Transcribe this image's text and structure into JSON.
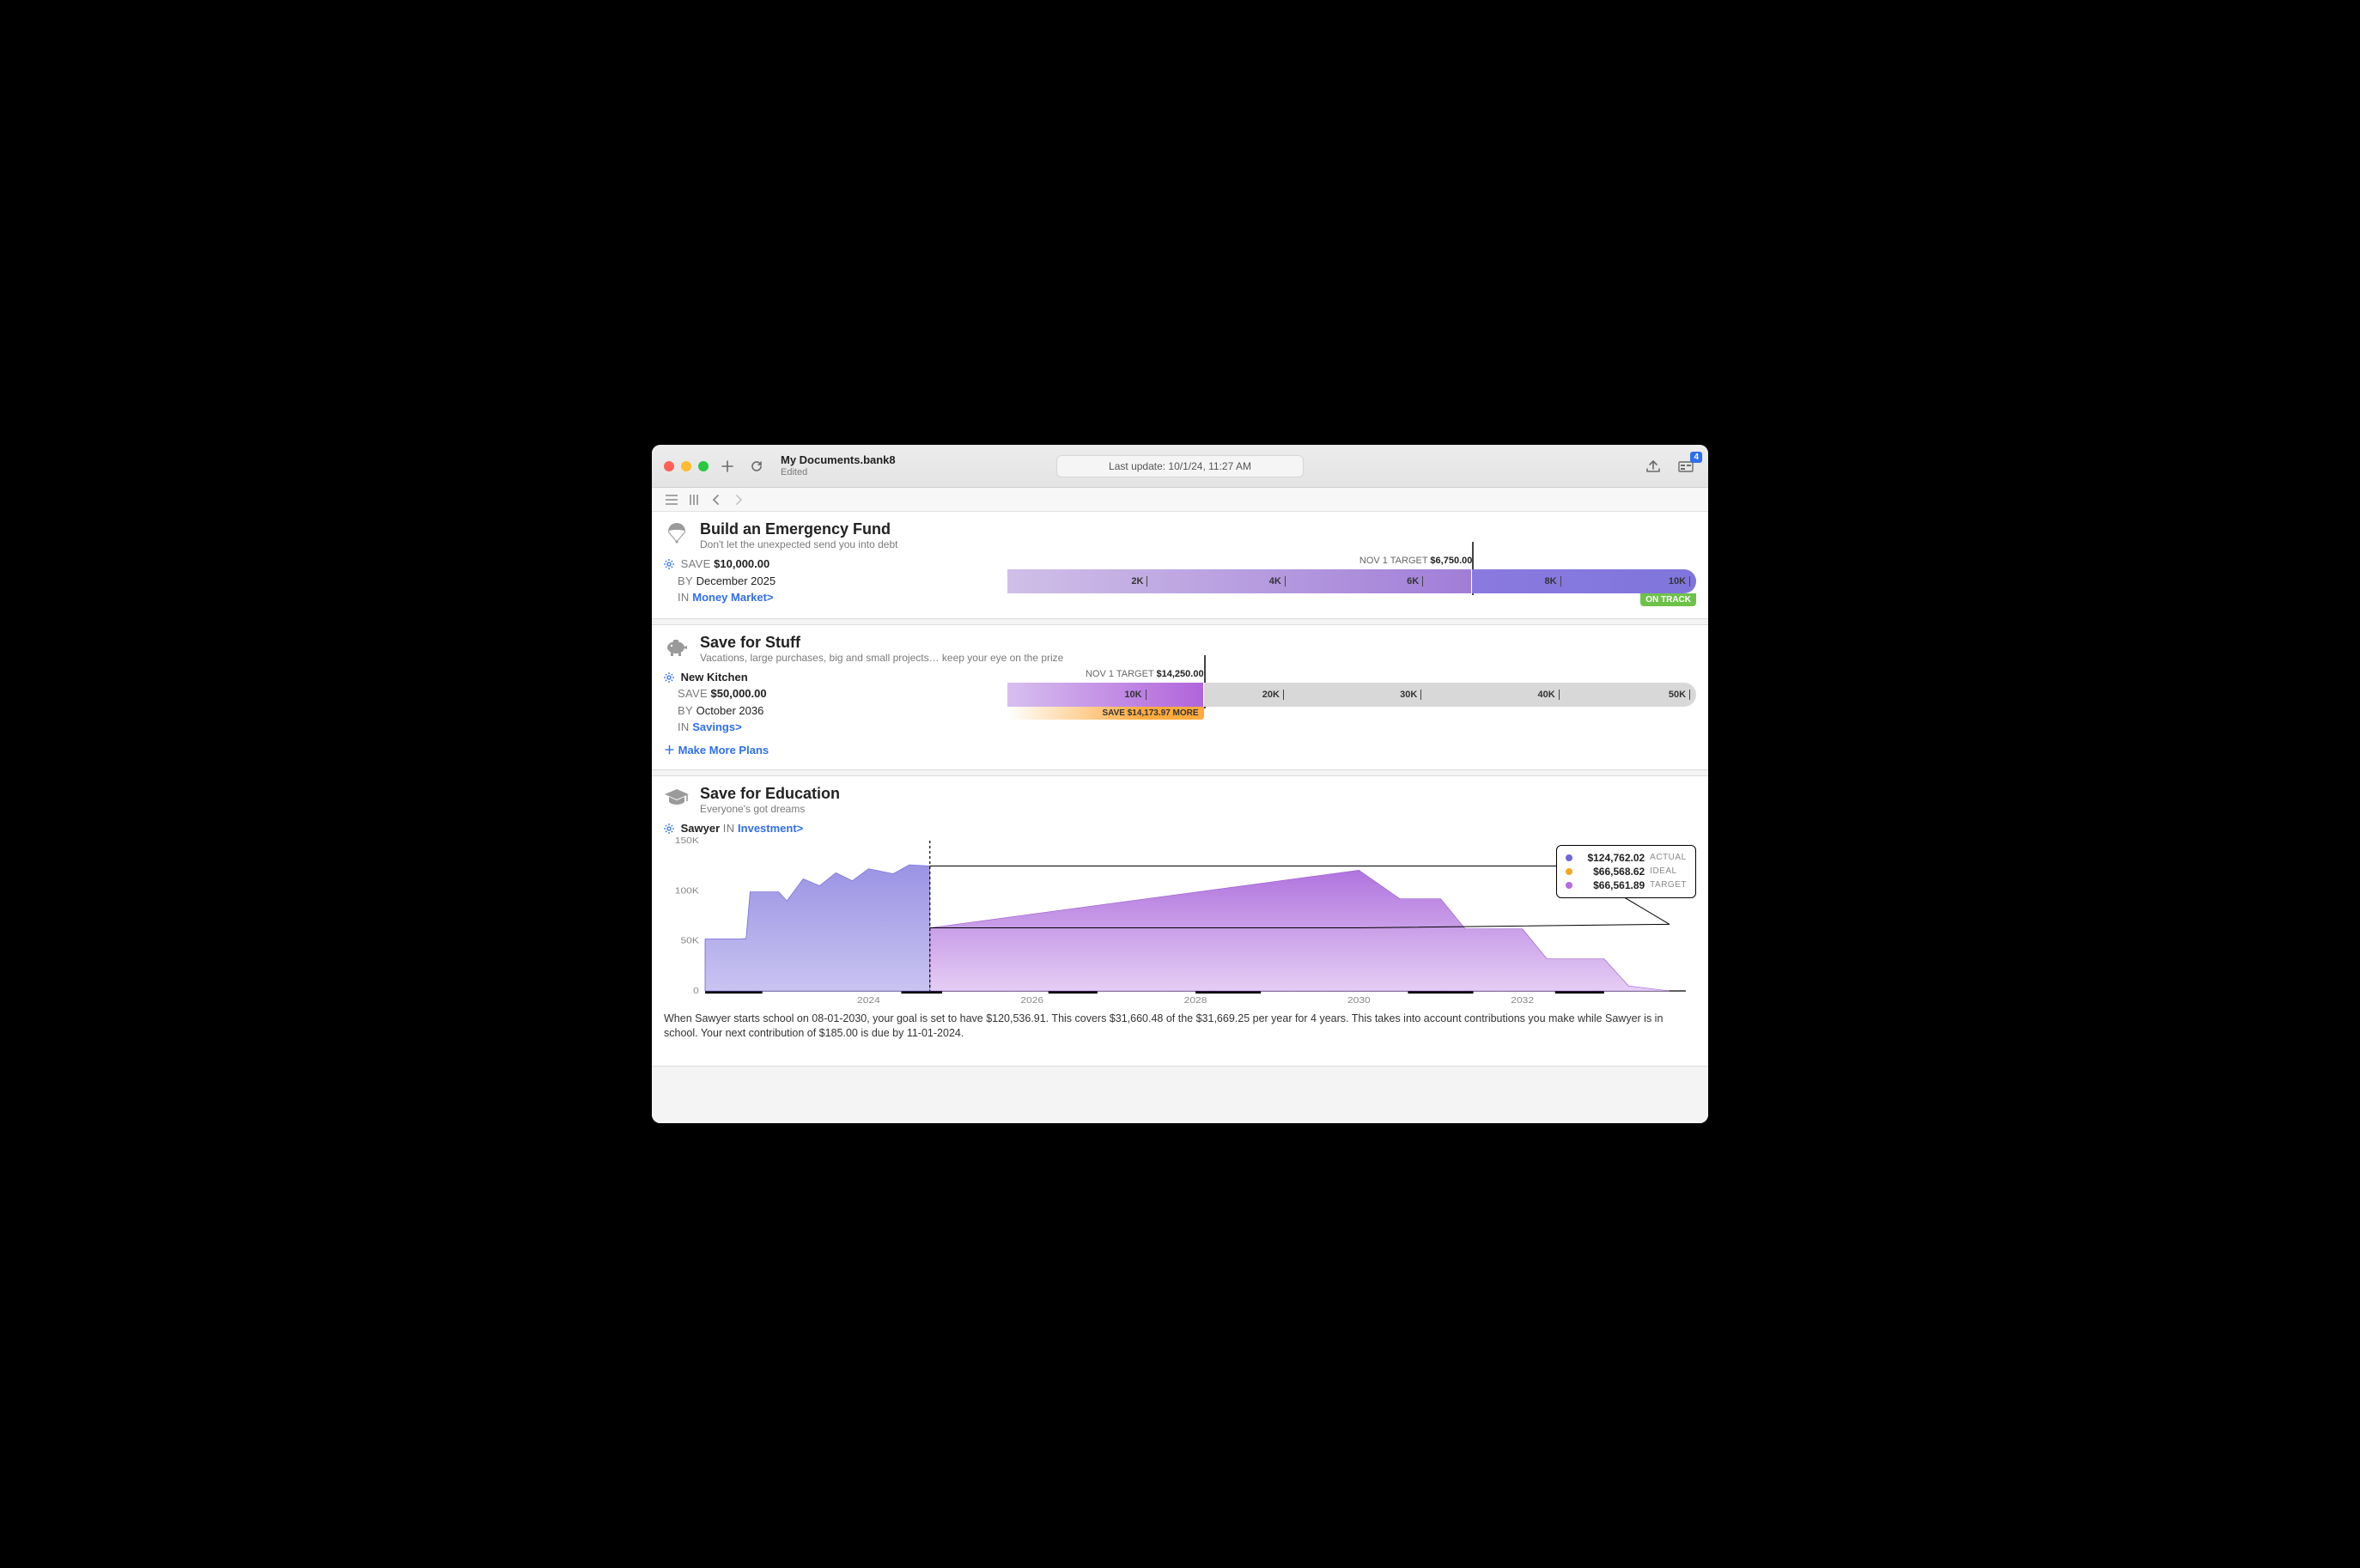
{
  "titlebar": {
    "filename": "My Documents.bank8",
    "subtitle": "Edited",
    "update": "Last update: 10/1/24, 11:27 AM",
    "badge_count": "4"
  },
  "goals": {
    "emergency": {
      "title": "Build an Emergency Fund",
      "subtitle": "Don't let the unexpected send you into debt",
      "save_word": "SAVE",
      "amount": "$10,000.00",
      "by_word": "BY",
      "deadline": "December 2025",
      "in_word": "IN",
      "account": "Money Market>",
      "target_label": "NOV 1 TARGET",
      "target_amount": "$6,750.00",
      "status": "ON TRACK",
      "ticks": [
        "2K",
        "4K",
        "6K",
        "8K",
        "10K"
      ]
    },
    "stuff": {
      "title": "Save for Stuff",
      "subtitle": "Vacations, large purchases, big and small projects… keep your eye on the prize",
      "name": "New Kitchen",
      "save_word": "SAVE",
      "amount": "$50,000.00",
      "by_word": "BY",
      "deadline": "October 2036",
      "in_word": "IN",
      "account": "Savings>",
      "target_label": "NOV 1 TARGET",
      "target_amount": "$14,250.00",
      "save_more_prefix": "SAVE ",
      "save_more_amount": "$14,173.97",
      "save_more_suffix": " MORE",
      "ticks": [
        "10K",
        "20K",
        "30K",
        "40K",
        "50K"
      ],
      "make_more": "Make More Plans"
    },
    "edu": {
      "title": "Save for Education",
      "subtitle": "Everyone's got dreams",
      "student": "Sawyer",
      "in_word": "IN",
      "account": "Investment>",
      "legend": {
        "actual": {
          "amount": "$124,762.02",
          "label": "ACTUAL",
          "color": "#6e67d6"
        },
        "ideal": {
          "amount": "$66,568.62",
          "label": "IDEAL",
          "color": "#f5a623"
        },
        "target": {
          "amount": "$66,561.89",
          "label": "TARGET",
          "color": "#b56be0"
        }
      },
      "desc": "When Sawyer starts school on 08-01-2030, your goal is set to have $120,536.91. This covers $31,660.48 of the $31,669.25 per year for 4 years. This takes into account contributions you make while Sawyer is in school. Your next contribution of $185.00 is due by 11-01-2024."
    }
  },
  "chart_data": {
    "type": "area",
    "xlabel": "",
    "ylabel": "",
    "ylim": [
      0,
      150000
    ],
    "y_ticks": [
      "0",
      "50K",
      "100K",
      "150K"
    ],
    "x_ticks": [
      "2024",
      "2026",
      "2028",
      "2030",
      "2032"
    ],
    "x_range": [
      2022,
      2034
    ],
    "current_x": 2024.75,
    "series": [
      {
        "name": "ACTUAL",
        "color": "#8f89e0",
        "points": [
          [
            2022.0,
            52000
          ],
          [
            2022.5,
            52000
          ],
          [
            2022.55,
            99000
          ],
          [
            2022.9,
            99000
          ],
          [
            2023.0,
            90000
          ],
          [
            2023.2,
            112000
          ],
          [
            2023.4,
            105000
          ],
          [
            2023.6,
            118000
          ],
          [
            2023.8,
            110000
          ],
          [
            2024.0,
            122000
          ],
          [
            2024.3,
            117000
          ],
          [
            2024.5,
            126000
          ],
          [
            2024.75,
            124762
          ]
        ]
      },
      {
        "name": "TARGET",
        "color": "#b77fe2",
        "points": [
          [
            2022.0,
            50000
          ],
          [
            2024.75,
            63000
          ],
          [
            2030.0,
            120537
          ],
          [
            2030.5,
            92000
          ],
          [
            2031.0,
            92000
          ],
          [
            2031.3,
            62000
          ],
          [
            2032.0,
            62000
          ],
          [
            2032.3,
            32000
          ],
          [
            2033.0,
            32000
          ],
          [
            2033.3,
            5000
          ],
          [
            2033.8,
            0
          ]
        ]
      },
      {
        "name": "PROJECTION_TOP",
        "color": "#000",
        "points": [
          [
            2024.75,
            124762
          ],
          [
            2032.6,
            124762
          ],
          [
            2033.8,
            66562
          ]
        ]
      },
      {
        "name": "PROJECTION_BOTTOM",
        "color": "#000",
        "points": [
          [
            2024.75,
            63000
          ],
          [
            2030.0,
            63000
          ],
          [
            2033.8,
            66562
          ]
        ]
      }
    ]
  }
}
